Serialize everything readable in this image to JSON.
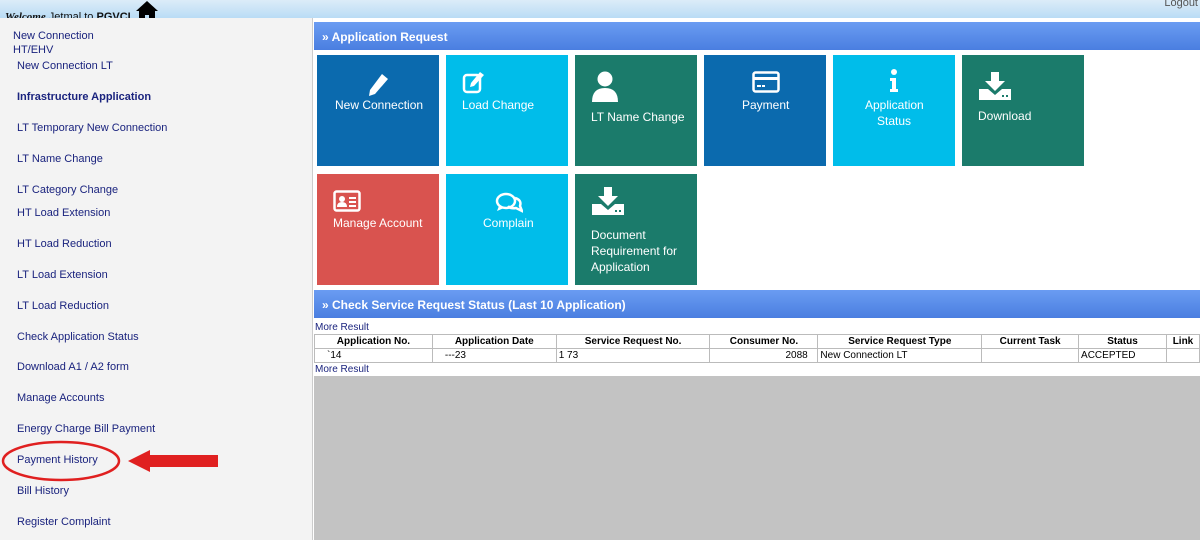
{
  "header": {
    "welcome_prefix": "Welcome",
    "welcome_user": "Jetmal to",
    "welcome_org": "PGVCL",
    "logout": "Logout"
  },
  "sidebar": {
    "items": [
      {
        "label": "New Connection"
      },
      {
        "label": "HT/EHV"
      },
      {
        "label": "New Connection LT"
      },
      {
        "label": "Infrastructure Application"
      },
      {
        "label": "LT Temporary New Connection"
      },
      {
        "label": "LT Name Change"
      },
      {
        "label": "LT Category Change"
      },
      {
        "label": "HT Load Extension"
      },
      {
        "label": "HT Load Reduction"
      },
      {
        "label": "LT Load Extension"
      },
      {
        "label": "LT Load Reduction"
      },
      {
        "label": "Check Application Status"
      },
      {
        "label": "Download A1 / A2 form"
      },
      {
        "label": "Manage Accounts"
      },
      {
        "label": "Energy Charge Bill Payment"
      },
      {
        "label": "Payment History"
      },
      {
        "label": "Bill History"
      },
      {
        "label": "Register Complaint"
      }
    ]
  },
  "app_request": {
    "title": "Application Request",
    "tiles": [
      {
        "label": "New Connection",
        "icon": "pencil-icon"
      },
      {
        "label": "Load Change",
        "icon": "edit-icon"
      },
      {
        "label": "LT Name Change",
        "icon": "user-icon"
      },
      {
        "label": "Payment",
        "icon": "credit-card-icon"
      },
      {
        "label": "Application Status",
        "icon": "info-icon"
      },
      {
        "label": "Download",
        "icon": "download-icon"
      },
      {
        "label": "Manage Account",
        "icon": "id-card-icon"
      },
      {
        "label": "Complain",
        "icon": "chat-icon"
      },
      {
        "label": "Document Requirement for Application",
        "icon": "download-icon"
      }
    ]
  },
  "status": {
    "title": "Check Service Request Status (Last 10 Application)",
    "more": "More Result",
    "columns": [
      "Application No.",
      "Application Date",
      "Service Request No.",
      "Consumer No.",
      "Service Request Type",
      "Current Task",
      "Status",
      "Link"
    ],
    "rows": [
      [
        "`14",
        "---23",
        "1      73",
        "2088",
        "New Connection LT",
        "",
        "ACCEPTED",
        ""
      ]
    ]
  },
  "colors": {
    "dark_blue": "#0b6aae",
    "cyan": "#00bdea",
    "teal": "#1b7b6b",
    "red": "#d9534f",
    "annotation": "#e02020"
  }
}
